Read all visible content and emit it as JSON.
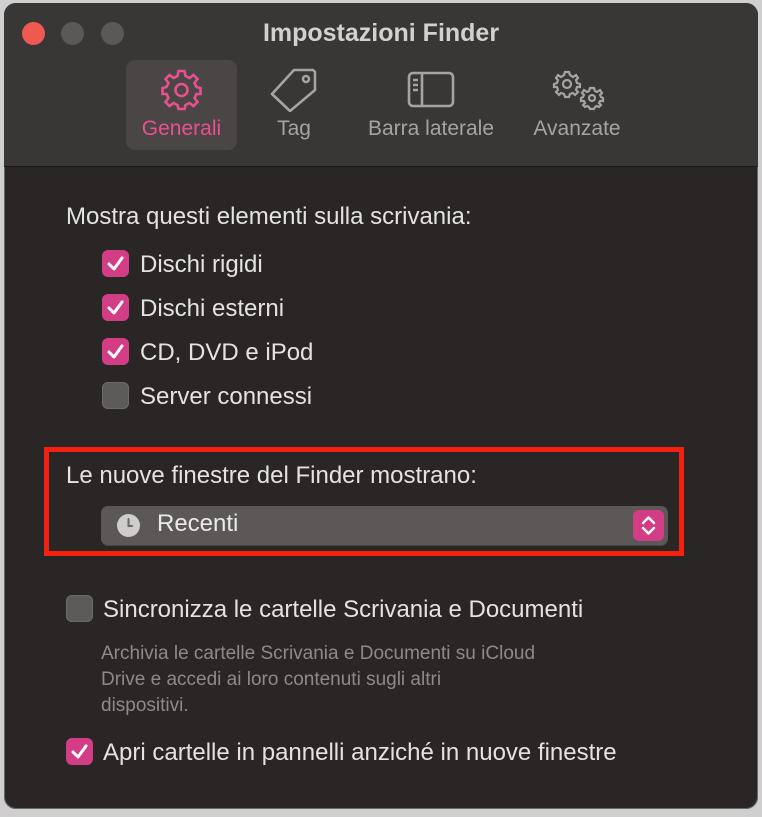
{
  "window": {
    "title": "Impostazioni Finder"
  },
  "tabs": [
    {
      "label": "Generali",
      "icon": "gear-icon",
      "active": true
    },
    {
      "label": "Tag",
      "icon": "tag-icon",
      "active": false
    },
    {
      "label": "Barra laterale",
      "icon": "sidebar-icon",
      "active": false
    },
    {
      "label": "Avanzate",
      "icon": "gears-icon",
      "active": false
    }
  ],
  "desktop_section": {
    "heading": "Mostra questi elementi sulla scrivania:",
    "items": [
      {
        "label": "Dischi rigidi",
        "checked": true
      },
      {
        "label": "Dischi esterni",
        "checked": true
      },
      {
        "label": "CD, DVD e iPod",
        "checked": true
      },
      {
        "label": "Server connessi",
        "checked": false
      }
    ]
  },
  "new_windows": {
    "label": "Le nuove finestre del Finder mostrano:",
    "selected": "Recenti",
    "icon": "clock-icon"
  },
  "sync": {
    "label": "Sincronizza le cartelle Scrivania e Documenti",
    "checked": false,
    "description_lines": [
      "Archivia le cartelle Scrivania e Documenti su iCloud",
      "Drive e accedi ai loro contenuti sugli altri",
      "dispositivi."
    ]
  },
  "tabs_option": {
    "label": "Apri cartelle in pannelli anziché in nuove finestre",
    "checked": true
  },
  "colors": {
    "accent": "#d23d85",
    "highlight": "#f42010",
    "window_bg": "#2b2626"
  }
}
